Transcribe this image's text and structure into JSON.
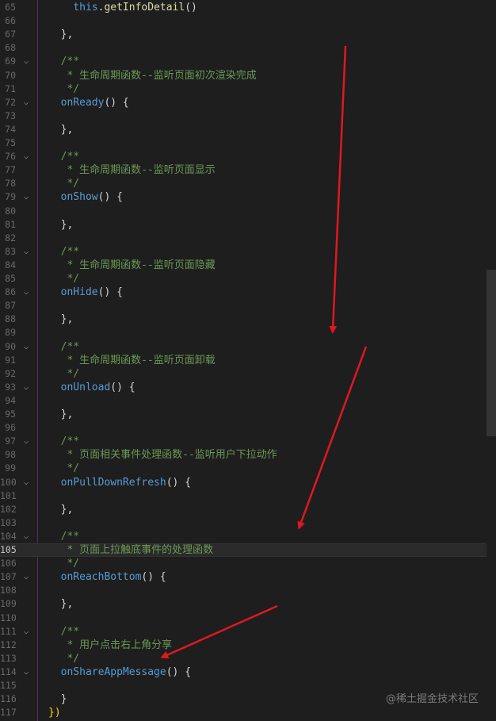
{
  "editor": {
    "lines": [
      {
        "num": "65",
        "parts": [
          {
            "t": "    ",
            "c": "tok-punc"
          },
          {
            "t": "this",
            "c": "tok-kw"
          },
          {
            "t": ".",
            "c": "tok-punc"
          },
          {
            "t": "getInfoDetail",
            "c": "tok-prop"
          },
          {
            "t": "()",
            "c": "tok-punc"
          }
        ],
        "fold": false
      },
      {
        "num": "66",
        "parts": [],
        "fold": false
      },
      {
        "num": "67",
        "parts": [
          {
            "t": "  },",
            "c": "tok-punc"
          }
        ],
        "fold": false
      },
      {
        "num": "68",
        "parts": [],
        "fold": false
      },
      {
        "num": "69",
        "parts": [
          {
            "t": "  /**",
            "c": "tok-comment"
          }
        ],
        "fold": true
      },
      {
        "num": "70",
        "parts": [
          {
            "t": "   * 生命周期函数--监听页面初次渲染完成",
            "c": "tok-comment"
          }
        ],
        "fold": false
      },
      {
        "num": "71",
        "parts": [
          {
            "t": "   */",
            "c": "tok-comment"
          }
        ],
        "fold": false
      },
      {
        "num": "72",
        "parts": [
          {
            "t": "  ",
            "c": "tok-punc"
          },
          {
            "t": "onReady",
            "c": "tok-fn"
          },
          {
            "t": "() {",
            "c": "tok-punc"
          }
        ],
        "fold": true
      },
      {
        "num": "73",
        "parts": [],
        "fold": false
      },
      {
        "num": "74",
        "parts": [
          {
            "t": "  },",
            "c": "tok-punc"
          }
        ],
        "fold": false
      },
      {
        "num": "75",
        "parts": [],
        "fold": false
      },
      {
        "num": "76",
        "parts": [
          {
            "t": "  /**",
            "c": "tok-comment"
          }
        ],
        "fold": true
      },
      {
        "num": "77",
        "parts": [
          {
            "t": "   * 生命周期函数--监听页面显示",
            "c": "tok-comment"
          }
        ],
        "fold": false
      },
      {
        "num": "78",
        "parts": [
          {
            "t": "   */",
            "c": "tok-comment"
          }
        ],
        "fold": false
      },
      {
        "num": "79",
        "parts": [
          {
            "t": "  ",
            "c": "tok-punc"
          },
          {
            "t": "onShow",
            "c": "tok-fn"
          },
          {
            "t": "() {",
            "c": "tok-punc"
          }
        ],
        "fold": true
      },
      {
        "num": "80",
        "parts": [],
        "fold": false
      },
      {
        "num": "81",
        "parts": [
          {
            "t": "  },",
            "c": "tok-punc"
          }
        ],
        "fold": false
      },
      {
        "num": "82",
        "parts": [],
        "fold": false
      },
      {
        "num": "83",
        "parts": [
          {
            "t": "  /**",
            "c": "tok-comment"
          }
        ],
        "fold": true
      },
      {
        "num": "84",
        "parts": [
          {
            "t": "   * 生命周期函数--监听页面隐藏",
            "c": "tok-comment"
          }
        ],
        "fold": false
      },
      {
        "num": "85",
        "parts": [
          {
            "t": "   */",
            "c": "tok-comment"
          }
        ],
        "fold": false
      },
      {
        "num": "86",
        "parts": [
          {
            "t": "  ",
            "c": "tok-punc"
          },
          {
            "t": "onHide",
            "c": "tok-fn"
          },
          {
            "t": "() {",
            "c": "tok-punc"
          }
        ],
        "fold": true
      },
      {
        "num": "87",
        "parts": [],
        "fold": false
      },
      {
        "num": "88",
        "parts": [
          {
            "t": "  },",
            "c": "tok-punc"
          }
        ],
        "fold": false
      },
      {
        "num": "89",
        "parts": [],
        "fold": false
      },
      {
        "num": "90",
        "parts": [
          {
            "t": "  /**",
            "c": "tok-comment"
          }
        ],
        "fold": true
      },
      {
        "num": "91",
        "parts": [
          {
            "t": "   * 生命周期函数--监听页面卸载",
            "c": "tok-comment"
          }
        ],
        "fold": false
      },
      {
        "num": "92",
        "parts": [
          {
            "t": "   */",
            "c": "tok-comment"
          }
        ],
        "fold": false
      },
      {
        "num": "93",
        "parts": [
          {
            "t": "  ",
            "c": "tok-punc"
          },
          {
            "t": "onUnload",
            "c": "tok-fn"
          },
          {
            "t": "() {",
            "c": "tok-punc"
          }
        ],
        "fold": true
      },
      {
        "num": "94",
        "parts": [],
        "fold": false
      },
      {
        "num": "95",
        "parts": [
          {
            "t": "  },",
            "c": "tok-punc"
          }
        ],
        "fold": false
      },
      {
        "num": "96",
        "parts": [],
        "fold": false
      },
      {
        "num": "97",
        "parts": [
          {
            "t": "  /**",
            "c": "tok-comment"
          }
        ],
        "fold": true
      },
      {
        "num": "98",
        "parts": [
          {
            "t": "   * 页面相关事件处理函数--监听用户下拉动作",
            "c": "tok-comment"
          }
        ],
        "fold": false
      },
      {
        "num": "99",
        "parts": [
          {
            "t": "   */",
            "c": "tok-comment"
          }
        ],
        "fold": false
      },
      {
        "num": "100",
        "parts": [
          {
            "t": "  ",
            "c": "tok-punc"
          },
          {
            "t": "onPullDownRefresh",
            "c": "tok-fn"
          },
          {
            "t": "() {",
            "c": "tok-punc"
          }
        ],
        "fold": true
      },
      {
        "num": "101",
        "parts": [],
        "fold": false
      },
      {
        "num": "102",
        "parts": [
          {
            "t": "  },",
            "c": "tok-punc"
          }
        ],
        "fold": false
      },
      {
        "num": "103",
        "parts": [],
        "fold": false
      },
      {
        "num": "104",
        "parts": [
          {
            "t": "  /**",
            "c": "tok-comment"
          }
        ],
        "fold": true
      },
      {
        "num": "105",
        "parts": [
          {
            "t": "   * 页面上拉触底事件的处理函数",
            "c": "tok-comment"
          }
        ],
        "fold": false,
        "current": true
      },
      {
        "num": "106",
        "parts": [
          {
            "t": "   */",
            "c": "tok-comment"
          }
        ],
        "fold": false
      },
      {
        "num": "107",
        "parts": [
          {
            "t": "  ",
            "c": "tok-punc"
          },
          {
            "t": "onReachBottom",
            "c": "tok-fn"
          },
          {
            "t": "() {",
            "c": "tok-punc"
          }
        ],
        "fold": true
      },
      {
        "num": "108",
        "parts": [],
        "fold": false
      },
      {
        "num": "109",
        "parts": [
          {
            "t": "  },",
            "c": "tok-punc"
          }
        ],
        "fold": false
      },
      {
        "num": "110",
        "parts": [],
        "fold": false
      },
      {
        "num": "111",
        "parts": [
          {
            "t": "  /**",
            "c": "tok-comment"
          }
        ],
        "fold": true
      },
      {
        "num": "112",
        "parts": [
          {
            "t": "   * 用户点击右上角分享",
            "c": "tok-comment"
          }
        ],
        "fold": false
      },
      {
        "num": "113",
        "parts": [
          {
            "t": "   */",
            "c": "tok-comment"
          }
        ],
        "fold": false
      },
      {
        "num": "114",
        "parts": [
          {
            "t": "  ",
            "c": "tok-punc"
          },
          {
            "t": "onShareAppMessage",
            "c": "tok-fn"
          },
          {
            "t": "() {",
            "c": "tok-punc"
          }
        ],
        "fold": true
      },
      {
        "num": "115",
        "parts": [],
        "fold": false
      },
      {
        "num": "116",
        "parts": [
          {
            "t": "  }",
            "c": "tok-punc"
          }
        ],
        "fold": false
      },
      {
        "num": "117",
        "parts": [
          {
            "t": "})",
            "c": "tok-end"
          }
        ],
        "fold": false
      }
    ]
  },
  "watermark": "@稀土掘金技术社区",
  "colors": {
    "background": "#1e1e1e",
    "comment": "#6a9955",
    "function": "#569cd6",
    "annotation_arrow": "#e0181f"
  },
  "icons": {
    "fold": "chevron-down-icon"
  }
}
